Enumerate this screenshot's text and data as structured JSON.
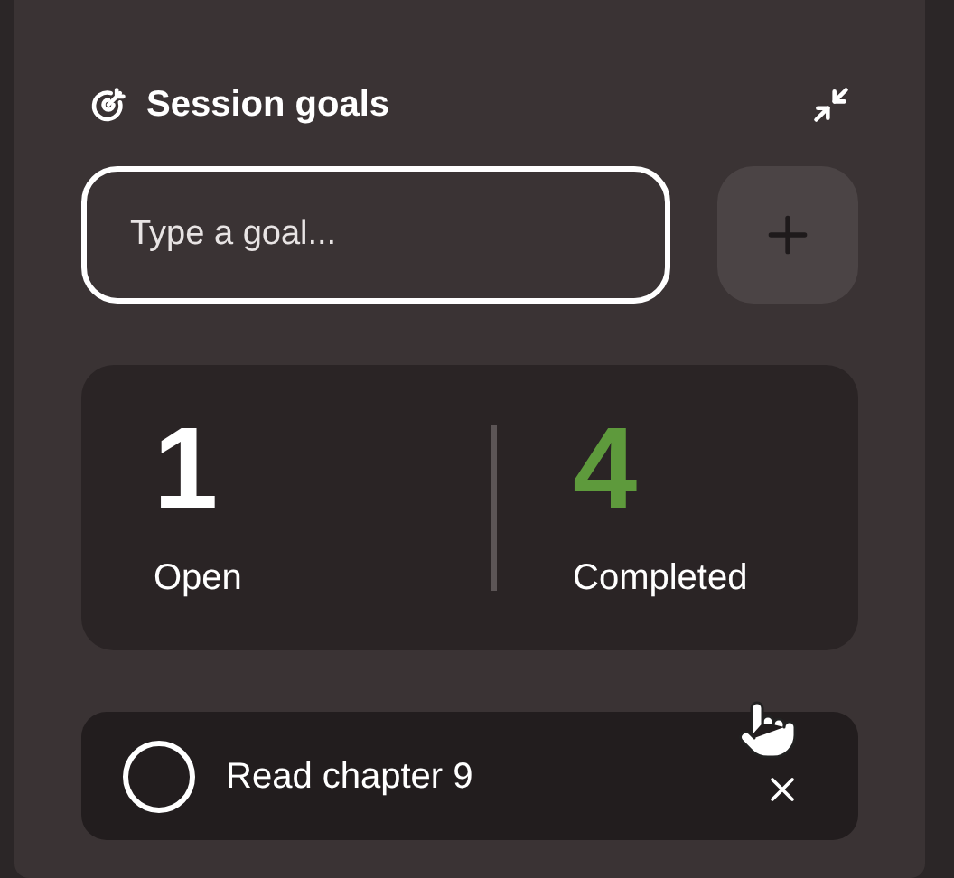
{
  "title": "Session goals",
  "goal_input": {
    "placeholder": "Type a goal..."
  },
  "stats": [
    {
      "value": "1",
      "label": "Open",
      "color": "#ffffff"
    },
    {
      "value": "4",
      "label": "Completed",
      "color": "#5e9a3c"
    }
  ],
  "goals": [
    {
      "text": "Read chapter 9",
      "checked": false
    }
  ]
}
